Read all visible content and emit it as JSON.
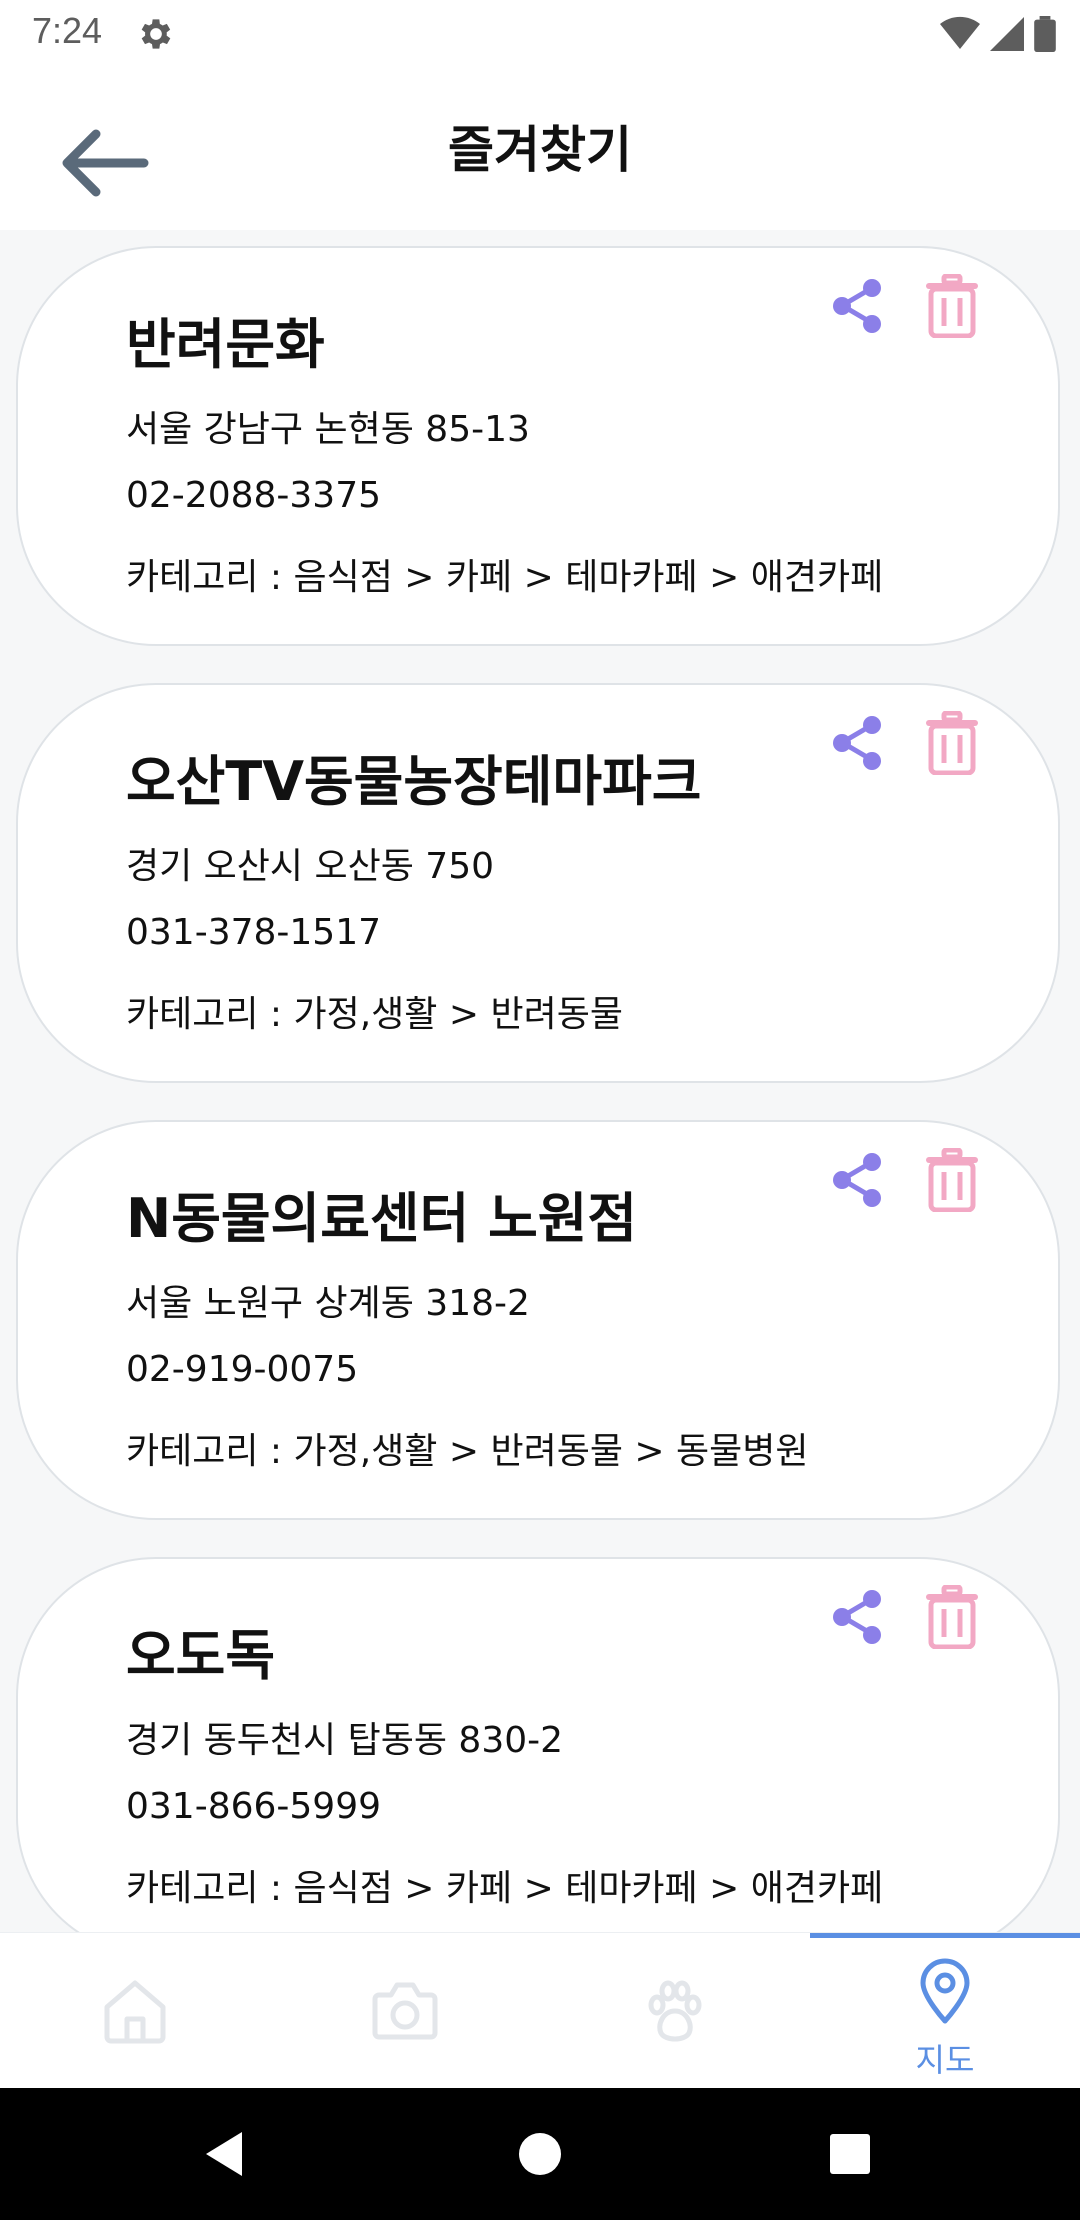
{
  "status_bar": {
    "time": "7:24"
  },
  "header": {
    "title": "즐겨찾기"
  },
  "favorites": [
    {
      "name": "반려문화",
      "address": "서울 강남구 논현동 85-13",
      "phone": "02-2088-3375",
      "category": "카테고리 : 음식점 > 카페 > 테마카페 > 애견카페"
    },
    {
      "name": "오산TV동물농장테마파크",
      "address": "경기 오산시 오산동 750",
      "phone": "031-378-1517",
      "category": "카테고리 : 가정,생활 > 반려동물"
    },
    {
      "name": "N동물의료센터 노원점",
      "address": "서울 노원구 상계동 318-2",
      "phone": "02-919-0075",
      "category": "카테고리 : 가정,생활 > 반려동물 > 동물병원"
    },
    {
      "name": "오도독",
      "address": "경기 동두천시 탑동동 830-2",
      "phone": "031-866-5999",
      "category": "카테고리 : 음식점 > 카페 > 테마카페 > 애견카페"
    }
  ],
  "bottom_nav": {
    "items": [
      {
        "icon": "home-icon",
        "label": ""
      },
      {
        "icon": "camera-icon",
        "label": ""
      },
      {
        "icon": "paw-icon",
        "label": ""
      },
      {
        "icon": "map-pin-icon",
        "label": "지도",
        "active": true
      }
    ]
  },
  "colors": {
    "share": "#8b7fe8",
    "trash": "#f2a8c4",
    "accent": "#5b8fe3",
    "inactive_icon": "#e3e6ea",
    "title": "#111111"
  }
}
